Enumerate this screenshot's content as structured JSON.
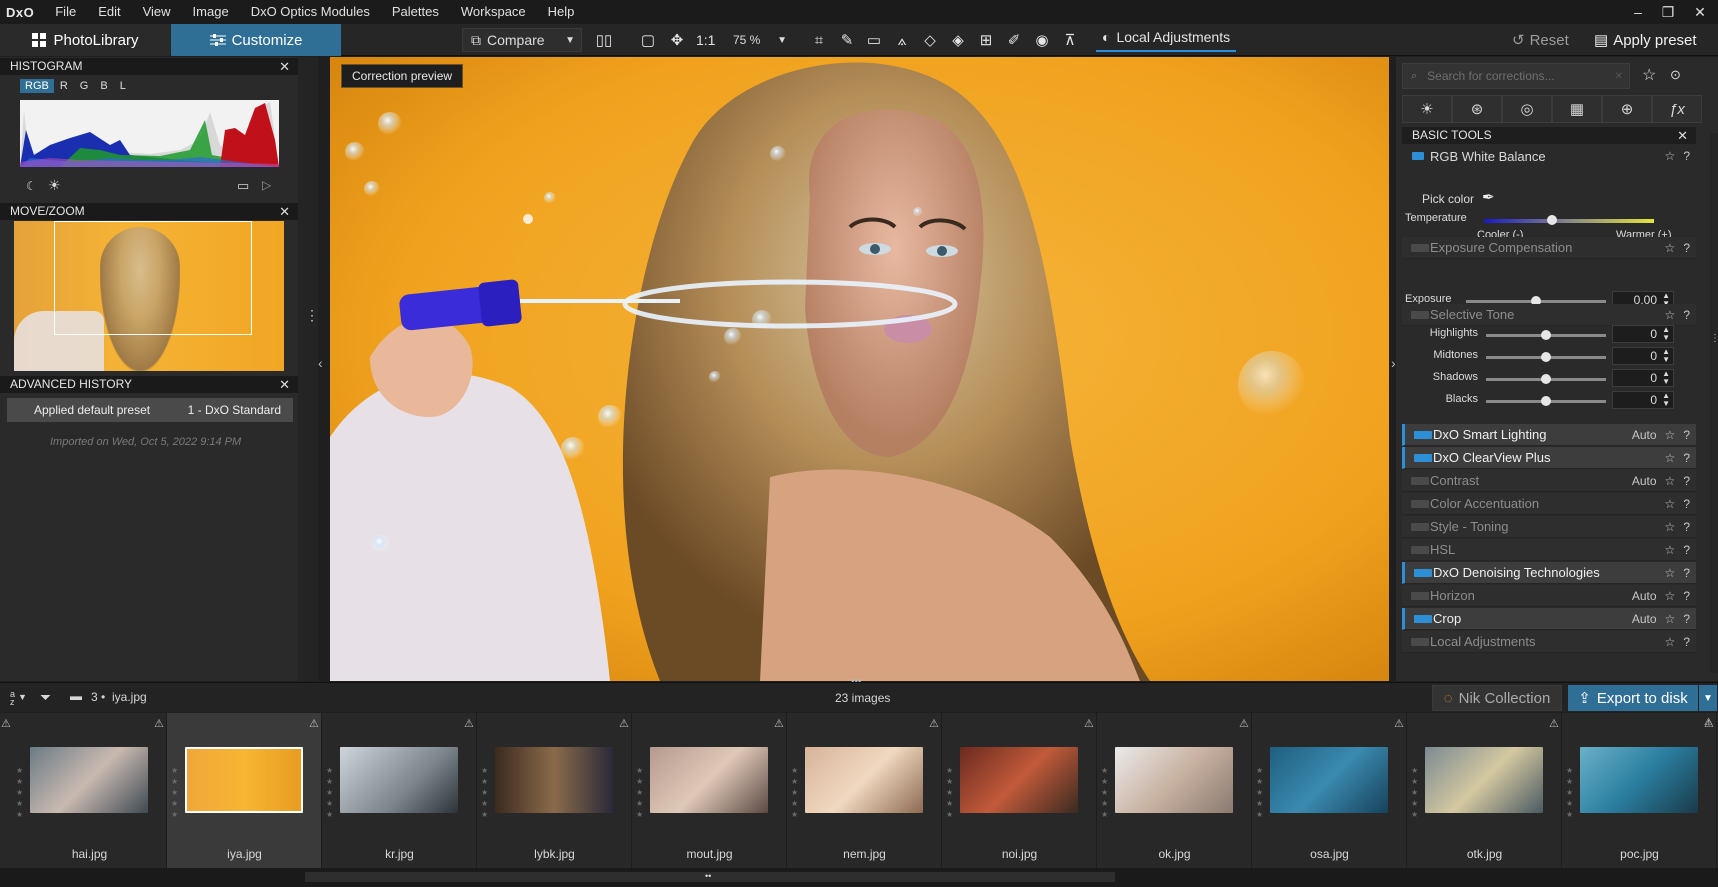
{
  "app": {
    "logo": "DxO"
  },
  "menu": [
    "File",
    "Edit",
    "View",
    "Image",
    "DxO Optics Modules",
    "Palettes",
    "Workspace",
    "Help"
  ],
  "window_controls": {
    "minimize": "–",
    "restore": "❐",
    "close": "✕"
  },
  "toolbar": {
    "photolibrary_label": "PhotoLibrary",
    "customize_label": "Customize",
    "compare_label": "Compare",
    "ratio_label": "1:1",
    "zoom_value": "75 %",
    "local_adjustments_label": "Local Adjustments",
    "reset_label": "Reset",
    "apply_preset_label": "Apply preset"
  },
  "histogram": {
    "title": "HISTOGRAM",
    "channels": [
      "RGB",
      "R",
      "G",
      "B",
      "L"
    ],
    "selected_channel": "RGB"
  },
  "movezoom": {
    "title": "MOVE/ZOOM"
  },
  "history": {
    "title": "ADVANCED HISTORY",
    "entry_label": "Applied default preset",
    "entry_value": "1 - DxO Standard",
    "imported_text": "Imported on Wed, Oct 5, 2022 9:14 PM"
  },
  "viewer": {
    "correction_preview_label": "Correction preview"
  },
  "right_panel": {
    "search_placeholder": "Search for corrections...",
    "section_title": "BASIC TOOLS",
    "white_balance": {
      "title": "RGB White Balance",
      "pick_color_label": "Pick color",
      "temperature_label": "Temperature",
      "cooler_label": "Cooler (-)",
      "warmer_label": "Warmer (+)",
      "temperature_level": 0.4
    },
    "exposure_comp": {
      "title": "Exposure Compensation",
      "exposure_label": "Exposure",
      "exposure_value": "0.00",
      "exposure_level": 0.5
    },
    "selective_tone": {
      "title": "Selective Tone",
      "rows": [
        {
          "label": "Highlights",
          "value": "0",
          "level": 0.5
        },
        {
          "label": "Midtones",
          "value": "0",
          "level": 0.5
        },
        {
          "label": "Shadows",
          "value": "0",
          "level": 0.5
        },
        {
          "label": "Blacks",
          "value": "0",
          "level": 0.5
        }
      ]
    },
    "tools": [
      {
        "label": "DxO Smart Lighting",
        "auto": "Auto",
        "active": true
      },
      {
        "label": "DxO ClearView Plus",
        "auto": "",
        "active": true
      },
      {
        "label": "Contrast",
        "auto": "Auto",
        "active": false
      },
      {
        "label": "Color Accentuation",
        "auto": "",
        "active": false
      },
      {
        "label": "Style - Toning",
        "auto": "",
        "active": false
      },
      {
        "label": "HSL",
        "auto": "",
        "active": false
      },
      {
        "label": "DxO Denoising Technologies",
        "auto": "",
        "active": true
      },
      {
        "label": "Horizon",
        "auto": "Auto",
        "active": false
      },
      {
        "label": "Crop",
        "auto": "Auto",
        "active": true
      },
      {
        "label": "Local Adjustments",
        "auto": "",
        "active": false
      }
    ]
  },
  "filmstrip": {
    "sort_label": "a z",
    "folder_count": "3",
    "folder_file": "iya.jpg",
    "images_count": "23 images",
    "nik_label": "Nik Collection",
    "export_label": "Export to disk",
    "thumbs": [
      {
        "name": "hai.jpg"
      },
      {
        "name": "iya.jpg",
        "selected": true
      },
      {
        "name": "kr.jpg"
      },
      {
        "name": "lybk.jpg"
      },
      {
        "name": "mout.jpg"
      },
      {
        "name": "nem.jpg"
      },
      {
        "name": "noi.jpg"
      },
      {
        "name": "ok.jpg"
      },
      {
        "name": "osa.jpg"
      },
      {
        "name": "otk.jpg"
      },
      {
        "name": "poc.jpg"
      }
    ]
  },
  "colors": {
    "accent": "#2d8fd5",
    "customize_tab": "#2f6f95",
    "backdrop": "#f2a21b"
  }
}
